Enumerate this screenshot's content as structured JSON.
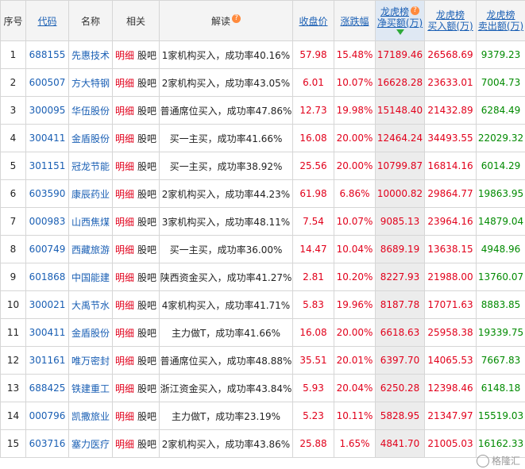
{
  "headers": {
    "idx": "序号",
    "code": "代码",
    "name": "名称",
    "related": "相关",
    "interp": "解读",
    "close": "收盘价",
    "change": "涨跌幅",
    "net_l1": "龙虎榜",
    "net_l2": "净买额(万)",
    "buy_l1": "龙虎榜",
    "buy_l2": "买入额(万)",
    "sell_l1": "龙虎榜",
    "sell_l2": "卖出额(万)"
  },
  "link_detail": "明细",
  "link_forum": "股吧",
  "rows": [
    {
      "idx": "1",
      "code": "688155",
      "name": "先惠技术",
      "interp": "1家机构买入，成功率40.16%",
      "close": "57.98",
      "change": "15.48%",
      "net": "17189.46",
      "buy": "26568.69",
      "sell": "9379.23"
    },
    {
      "idx": "2",
      "code": "600507",
      "name": "方大特钢",
      "interp": "2家机构买入，成功率43.05%",
      "close": "6.01",
      "change": "10.07%",
      "net": "16628.28",
      "buy": "23633.01",
      "sell": "7004.73"
    },
    {
      "idx": "3",
      "code": "300095",
      "name": "华伍股份",
      "interp": "普通席位买入，成功率47.86%",
      "close": "12.73",
      "change": "19.98%",
      "net": "15148.40",
      "buy": "21432.89",
      "sell": "6284.49"
    },
    {
      "idx": "4",
      "code": "300411",
      "name": "金盾股份",
      "interp": "买一主买，成功率41.66%",
      "close": "16.08",
      "change": "20.00%",
      "net": "12464.24",
      "buy": "34493.55",
      "sell": "22029.32"
    },
    {
      "idx": "5",
      "code": "301151",
      "name": "冠龙节能",
      "interp": "买一主买，成功率38.92%",
      "close": "25.56",
      "change": "20.00%",
      "net": "10799.87",
      "buy": "16814.16",
      "sell": "6014.29"
    },
    {
      "idx": "6",
      "code": "603590",
      "name": "康辰药业",
      "interp": "2家机构买入，成功率44.23%",
      "close": "61.98",
      "change": "6.86%",
      "net": "10000.82",
      "buy": "29864.77",
      "sell": "19863.95"
    },
    {
      "idx": "7",
      "code": "000983",
      "name": "山西焦煤",
      "interp": "3家机构买入，成功率48.11%",
      "close": "7.54",
      "change": "10.07%",
      "net": "9085.13",
      "buy": "23964.16",
      "sell": "14879.04"
    },
    {
      "idx": "8",
      "code": "600749",
      "name": "西藏旅游",
      "interp": "买一主买，成功率36.00%",
      "close": "14.47",
      "change": "10.04%",
      "net": "8689.19",
      "buy": "13638.15",
      "sell": "4948.96"
    },
    {
      "idx": "9",
      "code": "601868",
      "name": "中国能建",
      "interp": "陕西资金买入，成功率41.27%",
      "close": "2.81",
      "change": "10.20%",
      "net": "8227.93",
      "buy": "21988.00",
      "sell": "13760.07"
    },
    {
      "idx": "10",
      "code": "300021",
      "name": "大禹节水",
      "interp": "4家机构买入，成功率41.71%",
      "close": "5.83",
      "change": "19.96%",
      "net": "8187.78",
      "buy": "17071.63",
      "sell": "8883.85"
    },
    {
      "idx": "11",
      "code": "300411",
      "name": "金盾股份",
      "interp": "主力做T，成功率41.66%",
      "close": "16.08",
      "change": "20.00%",
      "net": "6618.63",
      "buy": "25958.38",
      "sell": "19339.75"
    },
    {
      "idx": "12",
      "code": "301161",
      "name": "唯万密封",
      "interp": "普通席位买入，成功率48.88%",
      "close": "35.51",
      "change": "20.01%",
      "net": "6397.70",
      "buy": "14065.53",
      "sell": "7667.83"
    },
    {
      "idx": "13",
      "code": "688425",
      "name": "铁建重工",
      "interp": "浙江资金买入，成功率43.84%",
      "close": "5.93",
      "change": "20.04%",
      "net": "6250.28",
      "buy": "12398.46",
      "sell": "6148.18"
    },
    {
      "idx": "14",
      "code": "000796",
      "name": "凯撒旅业",
      "interp": "主力做T，成功率23.19%",
      "close": "5.23",
      "change": "10.11%",
      "net": "5828.95",
      "buy": "21347.97",
      "sell": "15519.03"
    },
    {
      "idx": "15",
      "code": "603716",
      "name": "塞力医疗",
      "interp": "2家机构买入，成功率43.86%",
      "close": "25.88",
      "change": "1.65%",
      "net": "4841.70",
      "buy": "21005.03",
      "sell": "16162.33"
    }
  ],
  "watermark": "格隆汇",
  "colors": {
    "up": "#e1001b",
    "down": "#008a00",
    "link": "#1a5fb4",
    "sorted_col": "#ececec"
  },
  "icons": {
    "help": "question-circle-icon",
    "sort": "sort-desc-arrow-icon"
  }
}
